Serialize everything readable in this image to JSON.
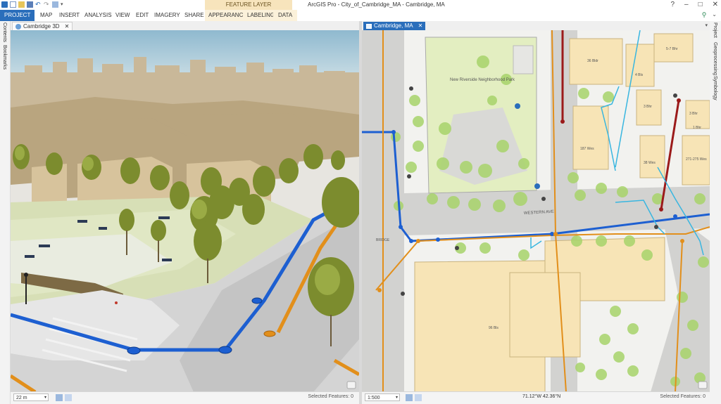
{
  "app_title": "ArcGIS Pro - City_of_Cambridge_MA - Cambridge, MA",
  "context_tab": "FEATURE LAYER",
  "ribbon_tabs": [
    {
      "label": "PROJECT"
    },
    {
      "label": "MAP"
    },
    {
      "label": "INSERT"
    },
    {
      "label": "ANALYSIS"
    },
    {
      "label": "VIEW"
    },
    {
      "label": "EDIT"
    },
    {
      "label": "IMAGERY"
    },
    {
      "label": "SHARE"
    },
    {
      "label": "APPEARANCE"
    },
    {
      "label": "LABELING"
    },
    {
      "label": "DATA"
    }
  ],
  "left_pane_tabs": [
    "Contents",
    "Bookmarks"
  ],
  "right_pane_tabs": [
    "Project",
    "Geoprocessing",
    "Symbology"
  ],
  "scene_view": {
    "tab_label": "Cambridge 3D",
    "scale": "22 m",
    "selected_features": "Selected Features: 0"
  },
  "map_view": {
    "tab_label": "Cambridge, MA",
    "scale": "1:500",
    "coordinates": "71.12°W 42.36°N",
    "selected_features": "Selected Features: 0",
    "labels": {
      "park": "New Riverside Neighborhood Park",
      "street": "WESTERN AVE",
      "bridge": "BRIDGE",
      "b1": "36 Bldr",
      "b2": "4 Bls",
      "b3": "5-7 Bhr",
      "b4": "3 Bhr",
      "b5": "3 Bhr",
      "b6": "1 Bhr",
      "b7": "187 Wes",
      "b8": "38 Wes",
      "b9": "271-275 Wes",
      "b10": "96 Bls"
    }
  },
  "colors": {
    "accent_blue": "#2a6ebb",
    "context_tab": "#f7e4bc",
    "water_line": "#1d5fd1",
    "sewer_line": "#e28f1b",
    "gas_line": "#9b1a1a",
    "service_line": "#38b6e0",
    "building_fill": "#f7e4b6",
    "park_fill": "#e3eec1",
    "tree": "#9ccf5b"
  }
}
